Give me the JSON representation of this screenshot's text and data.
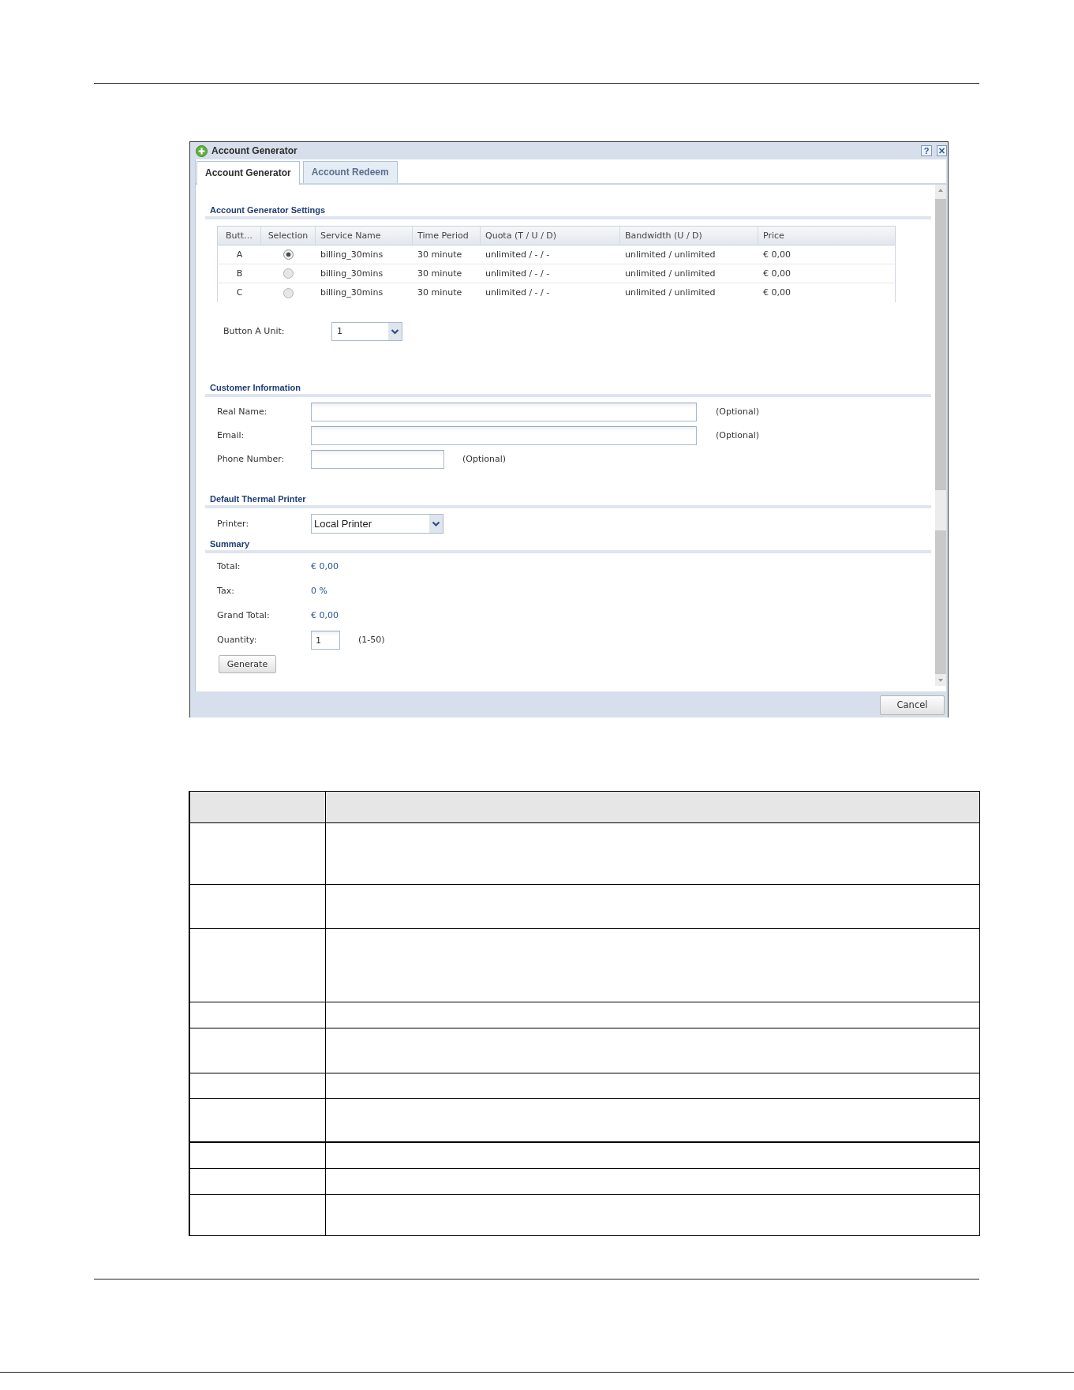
{
  "window": {
    "title": "Account Generator",
    "help_button": "?"
  },
  "tabs": [
    {
      "label": "Account Generator",
      "selected": true
    },
    {
      "label": "Account Redeem",
      "selected": false
    }
  ],
  "settings": {
    "title": "Account Generator Settings",
    "table": {
      "columns": [
        "Butt…",
        "Selection",
        "Service Name",
        "Time Period",
        "Quota (T / U / D)",
        "Bandwidth (U / D)",
        "Price"
      ],
      "rows": [
        {
          "button": "A",
          "selected": true,
          "service_name": "billing_30mins",
          "time_period": "30 minute",
          "quota": "unlimited / - / -",
          "bandwidth": "unlimited / unlimited",
          "price": "€ 0,00"
        },
        {
          "button": "B",
          "selected": false,
          "service_name": "billing_30mins",
          "time_period": "30 minute",
          "quota": "unlimited / - / -",
          "bandwidth": "unlimited / unlimited",
          "price": "€ 0,00"
        },
        {
          "button": "C",
          "selected": false,
          "service_name": "billing_30mins",
          "time_period": "30 minute",
          "quota": "unlimited / - / -",
          "bandwidth": "unlimited / unlimited",
          "price": "€ 0,00"
        }
      ]
    },
    "unit": {
      "label": "Button A Unit:",
      "value": "1"
    }
  },
  "customer_information": {
    "title": "Customer Information",
    "fields": [
      {
        "label": "Real Name:",
        "kind": "long",
        "note": "(Optional)"
      },
      {
        "label": "Email:",
        "kind": "long",
        "note": "(Optional)"
      },
      {
        "label": "Phone Number:",
        "kind": "short",
        "note": "(Optional)"
      }
    ]
  },
  "default_thermal_printer": {
    "title": "Default Thermal Printer",
    "printer": {
      "label": "Printer:",
      "value": "Local Printer"
    }
  },
  "summary": {
    "title": "Summary",
    "items": [
      {
        "label": "Total:",
        "value": "€ 0,00"
      },
      {
        "label": "Tax:",
        "value": "0 %"
      },
      {
        "label": "Grand Total:",
        "value": "€ 0,00"
      }
    ],
    "quantity": {
      "label": "Quantity:",
      "value": "1",
      "range": "(1-50)"
    },
    "generate_button": "Generate"
  },
  "footer": {
    "cancel_button": "Cancel"
  }
}
